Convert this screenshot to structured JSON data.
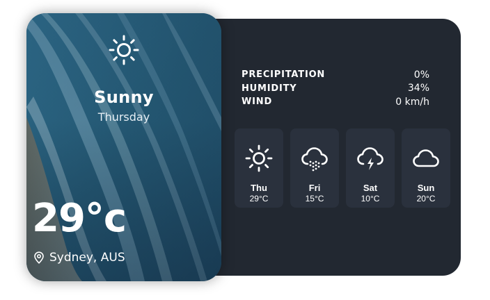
{
  "current": {
    "icon": "sun-icon",
    "condition": "Sunny",
    "day": "Thursday",
    "temperature": "29°c",
    "location": "Sydney, AUS",
    "location_icon": "map-pin-icon"
  },
  "stats": [
    {
      "label": "PRECIPITATION",
      "value": "0%"
    },
    {
      "label": "HUMIDITY",
      "value": "34%"
    },
    {
      "label": "WIND",
      "value": "0 km/h"
    }
  ],
  "forecast": [
    {
      "day": "Thu",
      "temp": "29°C",
      "icon": "sun-icon"
    },
    {
      "day": "Fri",
      "temp": "15°C",
      "icon": "cloud-hail-icon"
    },
    {
      "day": "Sat",
      "temp": "10°C",
      "icon": "cloud-lightning-icon"
    },
    {
      "day": "Sun",
      "temp": "20°C",
      "icon": "cloud-icon"
    }
  ],
  "colors": {
    "panel": "#222831",
    "tile": "#2a313d",
    "text": "#ffffff"
  }
}
